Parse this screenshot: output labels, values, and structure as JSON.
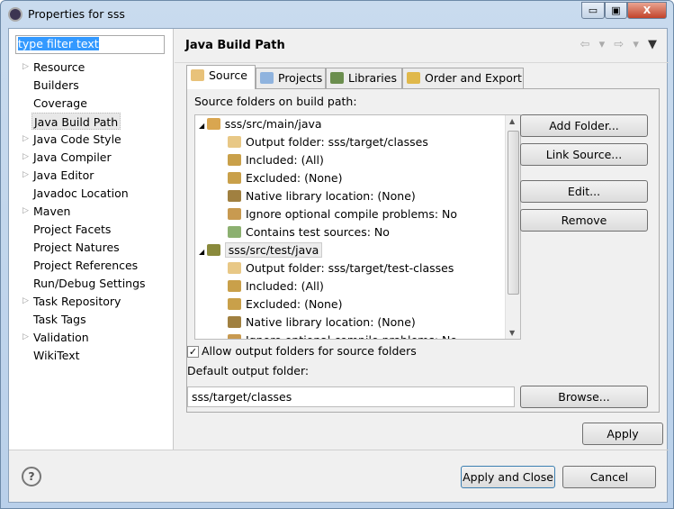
{
  "window": {
    "title": "Properties for sss",
    "minimize": "▭",
    "maximize": "▣",
    "close": "X"
  },
  "filter": {
    "value": "type filter text"
  },
  "nav": [
    {
      "label": "Resource",
      "expandable": true
    },
    {
      "label": "Builders",
      "expandable": false
    },
    {
      "label": "Coverage",
      "expandable": false
    },
    {
      "label": "Java Build Path",
      "expandable": false,
      "selected": true
    },
    {
      "label": "Java Code Style",
      "expandable": true
    },
    {
      "label": "Java Compiler",
      "expandable": true
    },
    {
      "label": "Java Editor",
      "expandable": true
    },
    {
      "label": "Javadoc Location",
      "expandable": false
    },
    {
      "label": "Maven",
      "expandable": true
    },
    {
      "label": "Project Facets",
      "expandable": false
    },
    {
      "label": "Project Natures",
      "expandable": false
    },
    {
      "label": "Project References",
      "expandable": false
    },
    {
      "label": "Run/Debug Settings",
      "expandable": false
    },
    {
      "label": "Task Repository",
      "expandable": true
    },
    {
      "label": "Task Tags",
      "expandable": false
    },
    {
      "label": "Validation",
      "expandable": true
    },
    {
      "label": "WikiText",
      "expandable": false
    }
  ],
  "header": {
    "title": "Java Build Path",
    "back": "⇦ ▾",
    "forward": "⇨ ▾",
    "menu": "▼"
  },
  "tabs": [
    {
      "label": "Source",
      "active": true
    },
    {
      "label": "Projects"
    },
    {
      "label": "Libraries"
    },
    {
      "label": "Order and Export"
    }
  ],
  "source": {
    "label": "Source folders on build path:",
    "tree": [
      {
        "level": 0,
        "text": "sss/src/main/java",
        "icon": "source-folder-icon"
      },
      {
        "level": 1,
        "text": "Output folder: sss/target/classes",
        "icon": "output-folder-icon"
      },
      {
        "level": 1,
        "text": "Included: (All)",
        "icon": "inclusion-filter-icon"
      },
      {
        "level": 1,
        "text": "Excluded: (None)",
        "icon": "exclusion-filter-icon"
      },
      {
        "level": 1,
        "text": "Native library location: (None)",
        "icon": "native-library-icon"
      },
      {
        "level": 1,
        "text": "Ignore optional compile problems: No",
        "icon": "ignore-problems-icon"
      },
      {
        "level": 1,
        "text": "Contains test sources: No",
        "icon": "test-sources-icon"
      },
      {
        "level": 0,
        "text": "sss/src/test/java",
        "icon": "test-source-folder-icon",
        "selected": true
      },
      {
        "level": 1,
        "text": "Output folder: sss/target/test-classes",
        "icon": "output-folder-icon"
      },
      {
        "level": 1,
        "text": "Included: (All)",
        "icon": "inclusion-filter-icon"
      },
      {
        "level": 1,
        "text": "Excluded: (None)",
        "icon": "exclusion-filter-icon"
      },
      {
        "level": 1,
        "text": "Native library location: (None)",
        "icon": "native-library-icon"
      },
      {
        "level": 1,
        "text": "Ignore optional compile problems: No",
        "icon": "ignore-problems-icon"
      }
    ],
    "buttons": {
      "add_folder": "Add Folder...",
      "link_source": "Link Source...",
      "edit": "Edit...",
      "remove": "Remove"
    },
    "allow_output": {
      "label": "Allow output folders for source folders",
      "checked": true
    },
    "default_output_label": "Default output folder:",
    "default_output_value": "sss/target/classes",
    "browse": "Browse..."
  },
  "apply": "Apply",
  "help": "?",
  "apply_close": "Apply and Close",
  "cancel": "Cancel"
}
